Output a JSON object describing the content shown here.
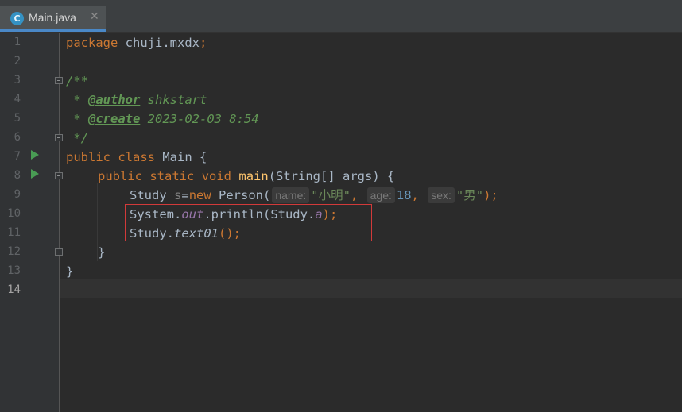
{
  "tab": {
    "icon_letter": "C",
    "file_name": "Main.java",
    "close_glyph": "✕"
  },
  "editor": {
    "line_numbers": [
      "1",
      "2",
      "3",
      "4",
      "5",
      "6",
      "7",
      "8",
      "9",
      "10",
      "11",
      "12",
      "13",
      "14"
    ],
    "current_line": "14",
    "code": {
      "l1": {
        "kw": "package",
        "pkg": " chuji.mxdx",
        "semi": ";"
      },
      "l3": "/**",
      "l4": {
        "star": " * ",
        "tag": "@author",
        "val": " shkstart"
      },
      "l5": {
        "star": " * ",
        "tag": "@create",
        "val": " 2023-02-03 8:54"
      },
      "l6": " */",
      "l7": {
        "kw1": "public",
        "kw2": "class",
        "name": " Main {"
      },
      "l8": {
        "kw1": "public",
        "kw2": "static",
        "kw3": "void",
        "fn": "main",
        "rest": "(String[] args) {"
      },
      "l9": {
        "type": "Study ",
        "var": "s",
        "eq": "=",
        "kw": "new",
        "ctor": " Person(",
        "hint_name": "name:",
        "arg_name": "\"小明\"",
        "comma1": ",",
        "hint_age": "age:",
        "arg_age": "18",
        "comma2": ",",
        "hint_sex": "sex:",
        "arg_sex": "\"男\"",
        "end": ");"
      },
      "l10": {
        "obj": "System.",
        "field": "out",
        "mid": ".println(Study.",
        "field2": "a",
        "end": ");"
      },
      "l11": {
        "obj": "Study.",
        "fn": "text01",
        "end": "();"
      },
      "l12": "}",
      "l13": "}"
    }
  },
  "colors": {
    "background": "#2b2b2b",
    "keyword": "#cc7832",
    "string": "#6a8759",
    "number": "#6897bb",
    "doc_comment": "#629755",
    "highlight_box": "#d23a3a",
    "run_icon": "#499c54"
  }
}
